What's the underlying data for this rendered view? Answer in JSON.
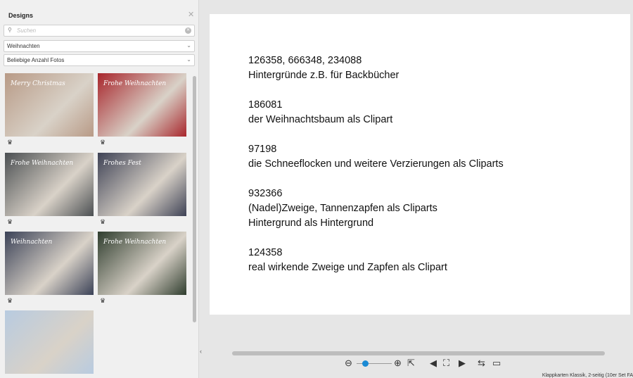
{
  "panel": {
    "title": "Designs",
    "search_placeholder": "Suchen",
    "category": "Weihnachten",
    "photos_filter": "Beliebige Anzahl Fotos",
    "thumbs": [
      {
        "text": "Merry Christmas",
        "color": "#b89a86"
      },
      {
        "text": "Frohe Weihnachten",
        "color": "#a8262c"
      },
      {
        "text": "Frohe Weihnachten",
        "color": "#4b4f52"
      },
      {
        "text": "Frohes Fest",
        "color": "#3e4255"
      },
      {
        "text": "Weihnachten",
        "color": "#3b4257"
      },
      {
        "text": "Frohe Weihnachten",
        "color": "#2f3d2e"
      },
      {
        "text": "",
        "color": "#b8cbe0"
      }
    ]
  },
  "document": {
    "paragraphs": [
      [
        "126358, 666348, 234088",
        "Hintergründe z.B. für Backbücher"
      ],
      [
        "186081",
        "der Weihnachtsbaum als Clipart"
      ],
      [
        "97198",
        "die Schneeflocken und weitere Verzierungen als Cliparts"
      ],
      [
        "932366",
        "(Nadel)Zweige, Tannenzapfen als Cliparts",
        "Hintergrund als Hintergrund"
      ],
      [
        "124358",
        "real wirkende Zweige und Zapfen als Clipart"
      ]
    ]
  },
  "toolbar": {
    "zoom_level": 0.15
  },
  "status": "Klappkarten Klassik, 2-seitig (10er Set FA"
}
